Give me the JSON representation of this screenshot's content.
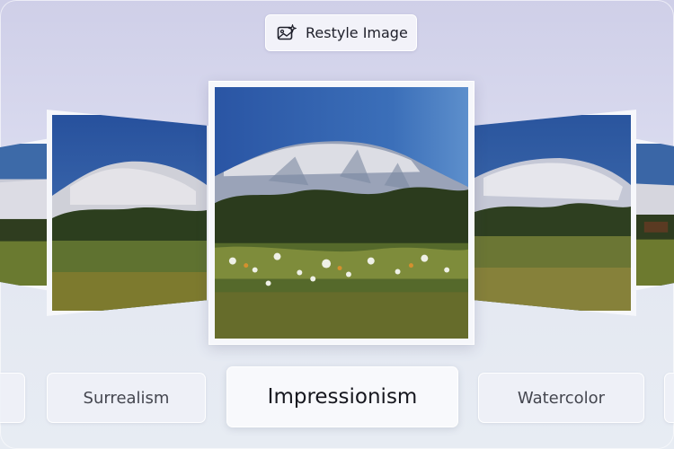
{
  "header": {
    "restyle_label": "Restyle Image",
    "restyle_icon": "image-sparkle-icon"
  },
  "carousel": {
    "images": [
      {
        "name": "far-left-preview"
      },
      {
        "name": "surrealism-preview"
      },
      {
        "name": "impressionism-preview"
      },
      {
        "name": "watercolor-preview"
      },
      {
        "name": "far-right-preview"
      }
    ]
  },
  "styles": {
    "items": [
      "Surrealism",
      "Impressionism",
      "Watercolor"
    ],
    "selected": "Impressionism"
  },
  "colors": {
    "sky": "#2f5ea8",
    "mountain": "#d8d8e0",
    "trees": "#2e3f1d",
    "meadow": "#6b7a2e"
  }
}
